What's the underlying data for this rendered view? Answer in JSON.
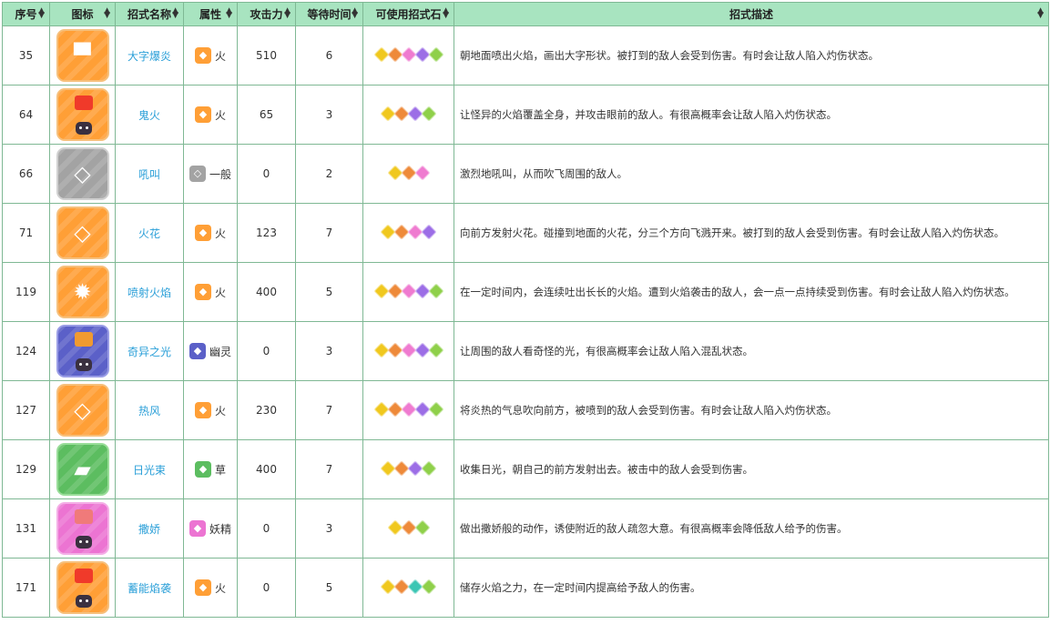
{
  "columns": [
    "序号",
    "图标",
    "招式名称",
    "属性",
    "攻击力",
    "等待时间",
    "可使用招式石",
    "招式描述"
  ],
  "stone_colors": {
    "yellow": "#f0c81e",
    "orange": "#ee8a3a",
    "pink": "#ef7bd0",
    "purple": "#9c6ee6",
    "green": "#8fd04a",
    "teal": "#3cc6b4"
  },
  "type_colors": {
    "fire": "#ff9f36",
    "normal": "#a3a3a3",
    "ghost": "#5b60c8",
    "grass": "#5cbd60",
    "fairy": "#ec74d2"
  },
  "rows": [
    {
      "id": "35",
      "icon": "fire-banner-icon",
      "icon_glyph": "▀",
      "icon_class": "fire",
      "name": "大字爆炎",
      "type_name": "火",
      "type_class": "fire",
      "type_glyph": "◆",
      "attack": "510",
      "wait": "6",
      "stones": [
        "yellow",
        "orange",
        "pink",
        "purple",
        "green"
      ],
      "desc": "朝地面喷出火焰，画出大字形状。被打到的敌人会受到伤害。有时会让敌人陷入灼伤状态。"
    },
    {
      "id": "64",
      "icon": "will-o-wisp-icon",
      "icon_glyph": "",
      "icon_class": "fire",
      "name": "鬼火",
      "type_name": "火",
      "type_class": "fire",
      "type_glyph": "◆",
      "attack": "65",
      "wait": "3",
      "stones": [
        "yellow",
        "orange",
        "purple",
        "green"
      ],
      "desc": "让怪异的火焰覆盖全身，并攻击眼前的敌人。有很高概率会让敌人陷入灼伤状态。"
    },
    {
      "id": "66",
      "icon": "roar-icon",
      "icon_glyph": "◇",
      "icon_class": "normal",
      "name": "吼叫",
      "type_name": "一般",
      "type_class": "normal",
      "type_glyph": "◇",
      "attack": "0",
      "wait": "2",
      "stones": [
        "yellow",
        "orange",
        "pink"
      ],
      "desc": "激烈地吼叫，从而吹飞周围的敌人。"
    },
    {
      "id": "71",
      "icon": "ember-icon",
      "icon_glyph": "◇",
      "icon_class": "fire",
      "name": "火花",
      "type_name": "火",
      "type_class": "fire",
      "type_glyph": "◆",
      "attack": "123",
      "wait": "7",
      "stones": [
        "yellow",
        "orange",
        "pink",
        "purple"
      ],
      "desc": "向前方发射火花。碰撞到地面的火花，分三个方向飞溅开来。被打到的敌人会受到伤害。有时会让敌人陷入灼伤状态。"
    },
    {
      "id": "119",
      "icon": "flamethrower-icon",
      "icon_glyph": "✹",
      "icon_class": "fire",
      "name": "喷射火焰",
      "type_name": "火",
      "type_class": "fire",
      "type_glyph": "◆",
      "attack": "400",
      "wait": "5",
      "stones": [
        "yellow",
        "orange",
        "pink",
        "purple",
        "green"
      ],
      "desc": "在一定时间内，会连续吐出长长的火焰。遭到火焰袭击的敌人，会一点一点持续受到伤害。有时会让敌人陷入灼伤状态。"
    },
    {
      "id": "124",
      "icon": "confuse-ray-icon",
      "icon_glyph": "",
      "icon_class": "ghost",
      "name": "奇异之光",
      "type_name": "幽灵",
      "type_class": "ghost",
      "type_glyph": "◆",
      "attack": "0",
      "wait": "3",
      "stones": [
        "yellow",
        "orange",
        "pink",
        "purple",
        "green"
      ],
      "desc": "让周围的敌人看奇怪的光，有很高概率会让敌人陷入混乱状态。"
    },
    {
      "id": "127",
      "icon": "heat-wave-icon",
      "icon_glyph": "◇",
      "icon_class": "fire",
      "name": "热风",
      "type_name": "火",
      "type_class": "fire",
      "type_glyph": "◆",
      "attack": "230",
      "wait": "7",
      "stones": [
        "yellow",
        "orange",
        "pink",
        "purple",
        "green"
      ],
      "desc": "将炎热的气息吹向前方，被喷到的敌人会受到伤害。有时会让敌人陷入灼伤状态。"
    },
    {
      "id": "129",
      "icon": "solar-beam-icon",
      "icon_glyph": "▰",
      "icon_class": "grass",
      "name": "日光束",
      "type_name": "草",
      "type_class": "grass",
      "type_glyph": "◆",
      "attack": "400",
      "wait": "7",
      "stones": [
        "yellow",
        "orange",
        "purple",
        "green"
      ],
      "desc": "收集日光，朝自己的前方发射出去。被击中的敌人会受到伤害。"
    },
    {
      "id": "131",
      "icon": "charm-icon",
      "icon_glyph": "",
      "icon_class": "fairy",
      "name": "撒娇",
      "type_name": "妖精",
      "type_class": "fairy",
      "type_glyph": "◆",
      "attack": "0",
      "wait": "3",
      "stones": [
        "yellow",
        "orange",
        "green"
      ],
      "desc": "做出撒娇般的动作，诱使附近的敌人疏忽大意。有很高概率会降低敌人给予的伤害。"
    },
    {
      "id": "171",
      "icon": "flame-charge-icon",
      "icon_glyph": "",
      "icon_class": "fire",
      "name": "蓄能焰袭",
      "type_name": "火",
      "type_class": "fire",
      "type_glyph": "◆",
      "attack": "0",
      "wait": "5",
      "stones": [
        "yellow",
        "orange",
        "teal",
        "green"
      ],
      "desc": "储存火焰之力，在一定时间内提高给予敌人的伤害。"
    }
  ]
}
